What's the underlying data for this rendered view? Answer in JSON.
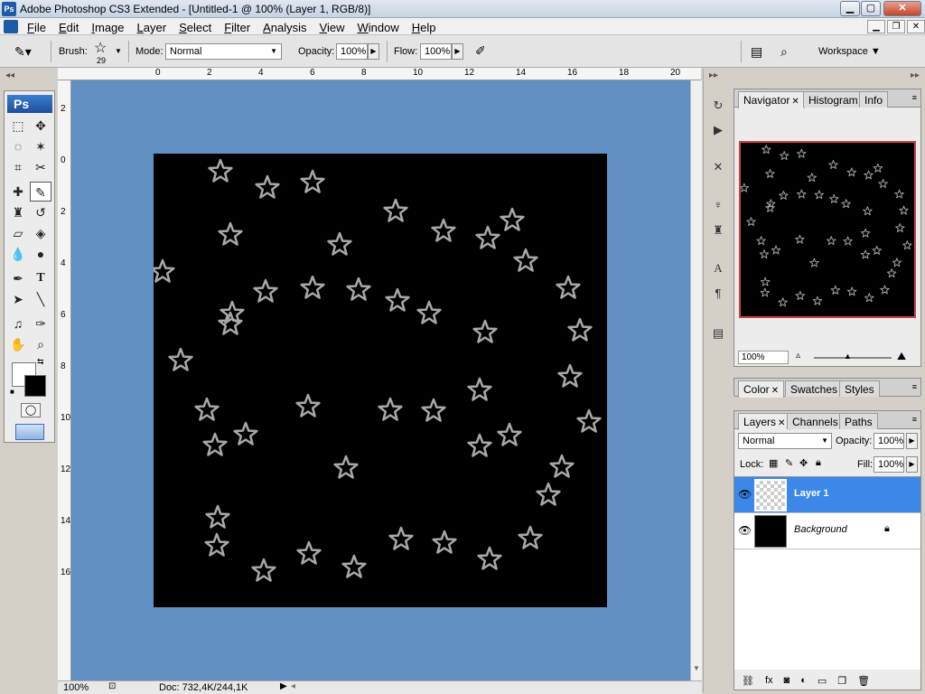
{
  "window": {
    "title": "Adobe Photoshop CS3 Extended - [Untitled-1 @ 100% (Layer 1, RGB/8)]",
    "app_icon": "Ps",
    "minimize": "▁",
    "maximize": "▢",
    "close": "✕"
  },
  "menu": {
    "items": [
      "File",
      "Edit",
      "Image",
      "Layer",
      "Select",
      "Filter",
      "Analysis",
      "View",
      "Window",
      "Help"
    ],
    "mdi_minimize": "▁",
    "mdi_restore": "❐",
    "mdi_close": "✕"
  },
  "options": {
    "brush_label": "Brush:",
    "brush_size": "29",
    "mode_label": "Mode:",
    "mode_value": "Normal",
    "opacity_label": "Opacity:",
    "opacity_value": "100%",
    "flow_label": "Flow:",
    "flow_value": "100%",
    "workspace_label": "Workspace ▼"
  },
  "toolbox": {
    "badge": "Ps"
  },
  "rulers": {
    "top_ticks": [
      "0",
      "2",
      "4",
      "6",
      "8",
      "10",
      "12",
      "14",
      "16",
      "18",
      "20"
    ],
    "left_ticks": [
      "2",
      "0",
      "2",
      "4",
      "6",
      "8",
      "10",
      "12",
      "14",
      "16"
    ]
  },
  "status": {
    "zoom": "100%",
    "doc_info": "Doc: 732,4K/244,1K"
  },
  "navigator": {
    "tabs": [
      "Navigator",
      "Histogram",
      "Info"
    ],
    "zoom": "100%"
  },
  "color_panel": {
    "tabs": [
      "Color",
      "Swatches",
      "Styles"
    ]
  },
  "layers_panel": {
    "tabs": [
      "Layers",
      "Channels",
      "Paths"
    ],
    "blend_mode": "Normal",
    "opacity_label": "Opacity:",
    "opacity_value": "100%",
    "lock_label": "Lock:",
    "fill_label": "Fill:",
    "fill_value": "100%",
    "layers": [
      {
        "name": "Layer 1",
        "selected": true
      },
      {
        "name": "Background",
        "selected": false
      }
    ]
  },
  "colors": {
    "canvas_bg": "#6190c3",
    "document": "#000000",
    "star_stroke": "#a8a8a8",
    "selection": "#3c87e8"
  }
}
